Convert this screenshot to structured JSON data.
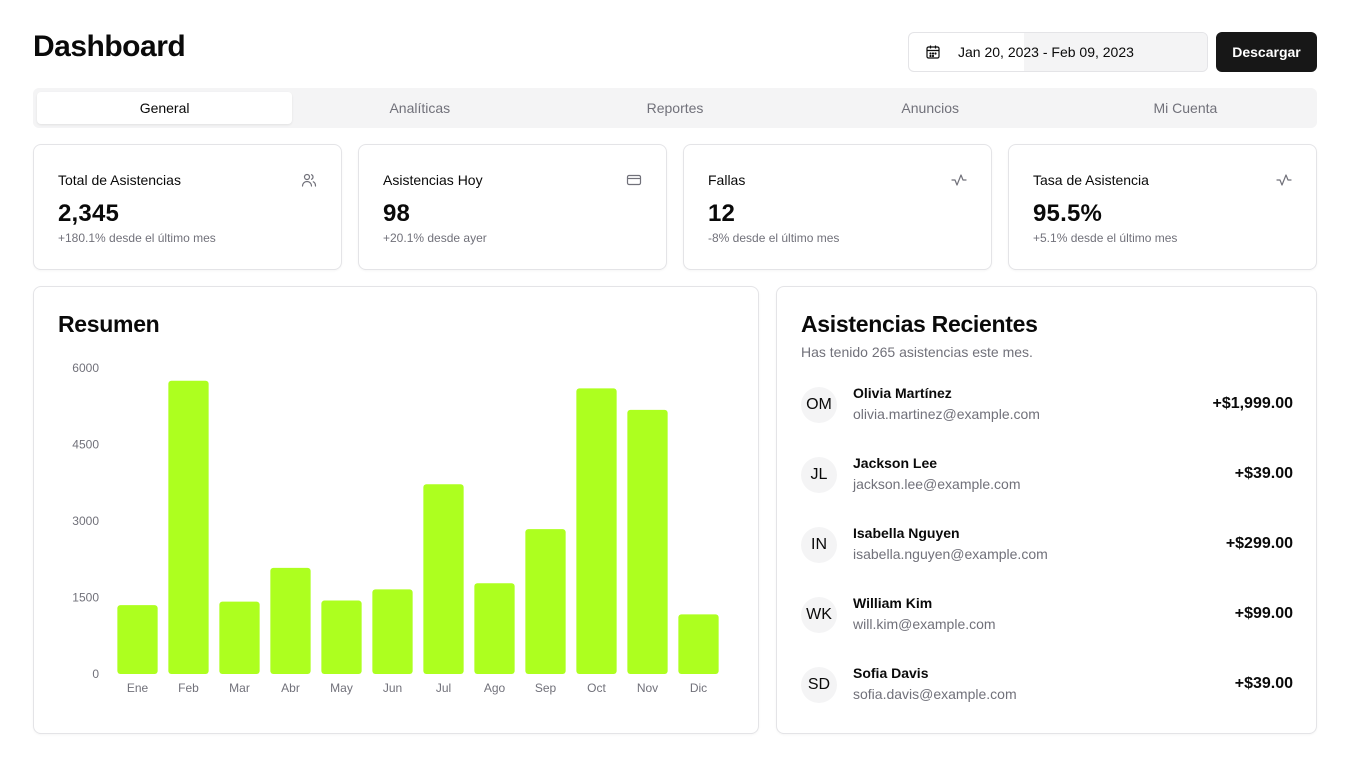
{
  "header": {
    "title": "Dashboard",
    "date_range": "Jan 20, 2023 - Feb 09, 2023",
    "download_label": "Descargar"
  },
  "tabs": [
    {
      "label": "General",
      "active": true
    },
    {
      "label": "Analíticas",
      "active": false
    },
    {
      "label": "Reportes",
      "active": false
    },
    {
      "label": "Anuncios",
      "active": false
    },
    {
      "label": "Mi Cuenta",
      "active": false
    }
  ],
  "stats": [
    {
      "label": "Total de Asistencias",
      "value": "2,345",
      "delta": "+180.1% desde el último mes",
      "icon": "users-icon"
    },
    {
      "label": "Asistencias Hoy",
      "value": "98",
      "delta": "+20.1% desde ayer",
      "icon": "credit-card-icon"
    },
    {
      "label": "Fallas",
      "value": "12",
      "delta": "-8% desde el último mes",
      "icon": "activity-icon"
    },
    {
      "label": "Tasa de Asistencia",
      "value": "95.5%",
      "delta": "+5.1% desde el último mes",
      "icon": "activity-icon"
    }
  ],
  "overview": {
    "title": "Resumen"
  },
  "chart_data": {
    "type": "bar",
    "title": "Resumen",
    "categories": [
      "Ene",
      "Feb",
      "Mar",
      "Abr",
      "May",
      "Jun",
      "Jul",
      "Ago",
      "Sep",
      "Oct",
      "Nov",
      "Dic"
    ],
    "values": [
      1350,
      5750,
      1420,
      2080,
      1440,
      1660,
      3720,
      1780,
      2840,
      5600,
      5180,
      1170
    ],
    "yticks": [
      0,
      1500,
      3000,
      4500,
      6000
    ],
    "yticks_label": [
      "0",
      "1500",
      "3000",
      "4500",
      "6000"
    ],
    "ylim": [
      0,
      6000
    ],
    "grid": false,
    "color": "#adff1f"
  },
  "recent": {
    "title": "Asistencias Recientes",
    "subtitle": "Has tenido 265 asistencias este mes.",
    "items": [
      {
        "initials": "OM",
        "name": "Olivia Martínez",
        "email": "olivia.martinez@example.com",
        "amount": "+$1,999.00"
      },
      {
        "initials": "JL",
        "name": "Jackson Lee",
        "email": "jackson.lee@example.com",
        "amount": "+$39.00"
      },
      {
        "initials": "IN",
        "name": "Isabella Nguyen",
        "email": "isabella.nguyen@example.com",
        "amount": "+$299.00"
      },
      {
        "initials": "WK",
        "name": "William Kim",
        "email": "will.kim@example.com",
        "amount": "+$99.00"
      },
      {
        "initials": "SD",
        "name": "Sofia Davis",
        "email": "sofia.davis@example.com",
        "amount": "+$39.00"
      }
    ]
  }
}
